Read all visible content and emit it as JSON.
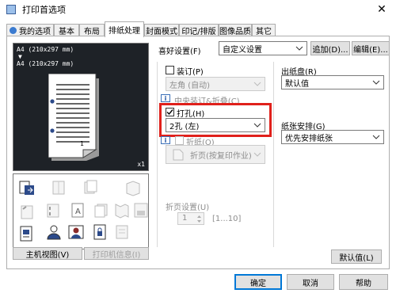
{
  "window": {
    "title": "打印首选项",
    "close_glyph": "✕"
  },
  "tabs": [
    {
      "label": "我的选项",
      "active": false
    },
    {
      "label": "基本",
      "active": false
    },
    {
      "label": "布局",
      "active": false
    },
    {
      "label": "排纸处理",
      "active": true
    },
    {
      "label": "封面模式",
      "active": false
    },
    {
      "label": "印记/排版",
      "active": false
    },
    {
      "label": "图像品质",
      "active": false
    },
    {
      "label": "其它",
      "active": false
    }
  ],
  "preview": {
    "paper_line_1": "A4 (210x297 mm)",
    "arrow": "▼",
    "paper_line_2": "A4 (210x297 mm)",
    "page_number": "1",
    "copies": "x1"
  },
  "left_buttons": {
    "printer_view": "主机视图(V)",
    "printer_info": "打印机信息(I)"
  },
  "favorites": {
    "label": "喜好设置(F)",
    "value": "自定义设置",
    "add": "追加(D)...",
    "edit": "编辑(E)..."
  },
  "staple": {
    "label": "装订(P)",
    "checked": false,
    "value": "左角 (自动)"
  },
  "center_staple": {
    "label": "中央装订&折叠(C)",
    "info": "i"
  },
  "punch": {
    "label": "打孔(H)",
    "checked": true,
    "value": "2孔 (左)",
    "info": "i"
  },
  "fold": {
    "label": "折纸(O)",
    "checked": false,
    "value": "折页(按复印作业)"
  },
  "fold_pages": {
    "label": "折页设置(U)",
    "value": "1",
    "range": "[1...10]"
  },
  "output_tray": {
    "label": "出纸盘(R)",
    "value": "默认值"
  },
  "paper_arrangement": {
    "label": "纸张安排(G)",
    "value": "优先安排纸张"
  },
  "default_button": "默认值(L)",
  "footer": {
    "ok": "确定",
    "cancel": "取消",
    "help": "帮助"
  },
  "colors": {
    "highlight": "#e0201b",
    "preview_bg": "#1e2227",
    "focus_border": "#0078d7"
  }
}
